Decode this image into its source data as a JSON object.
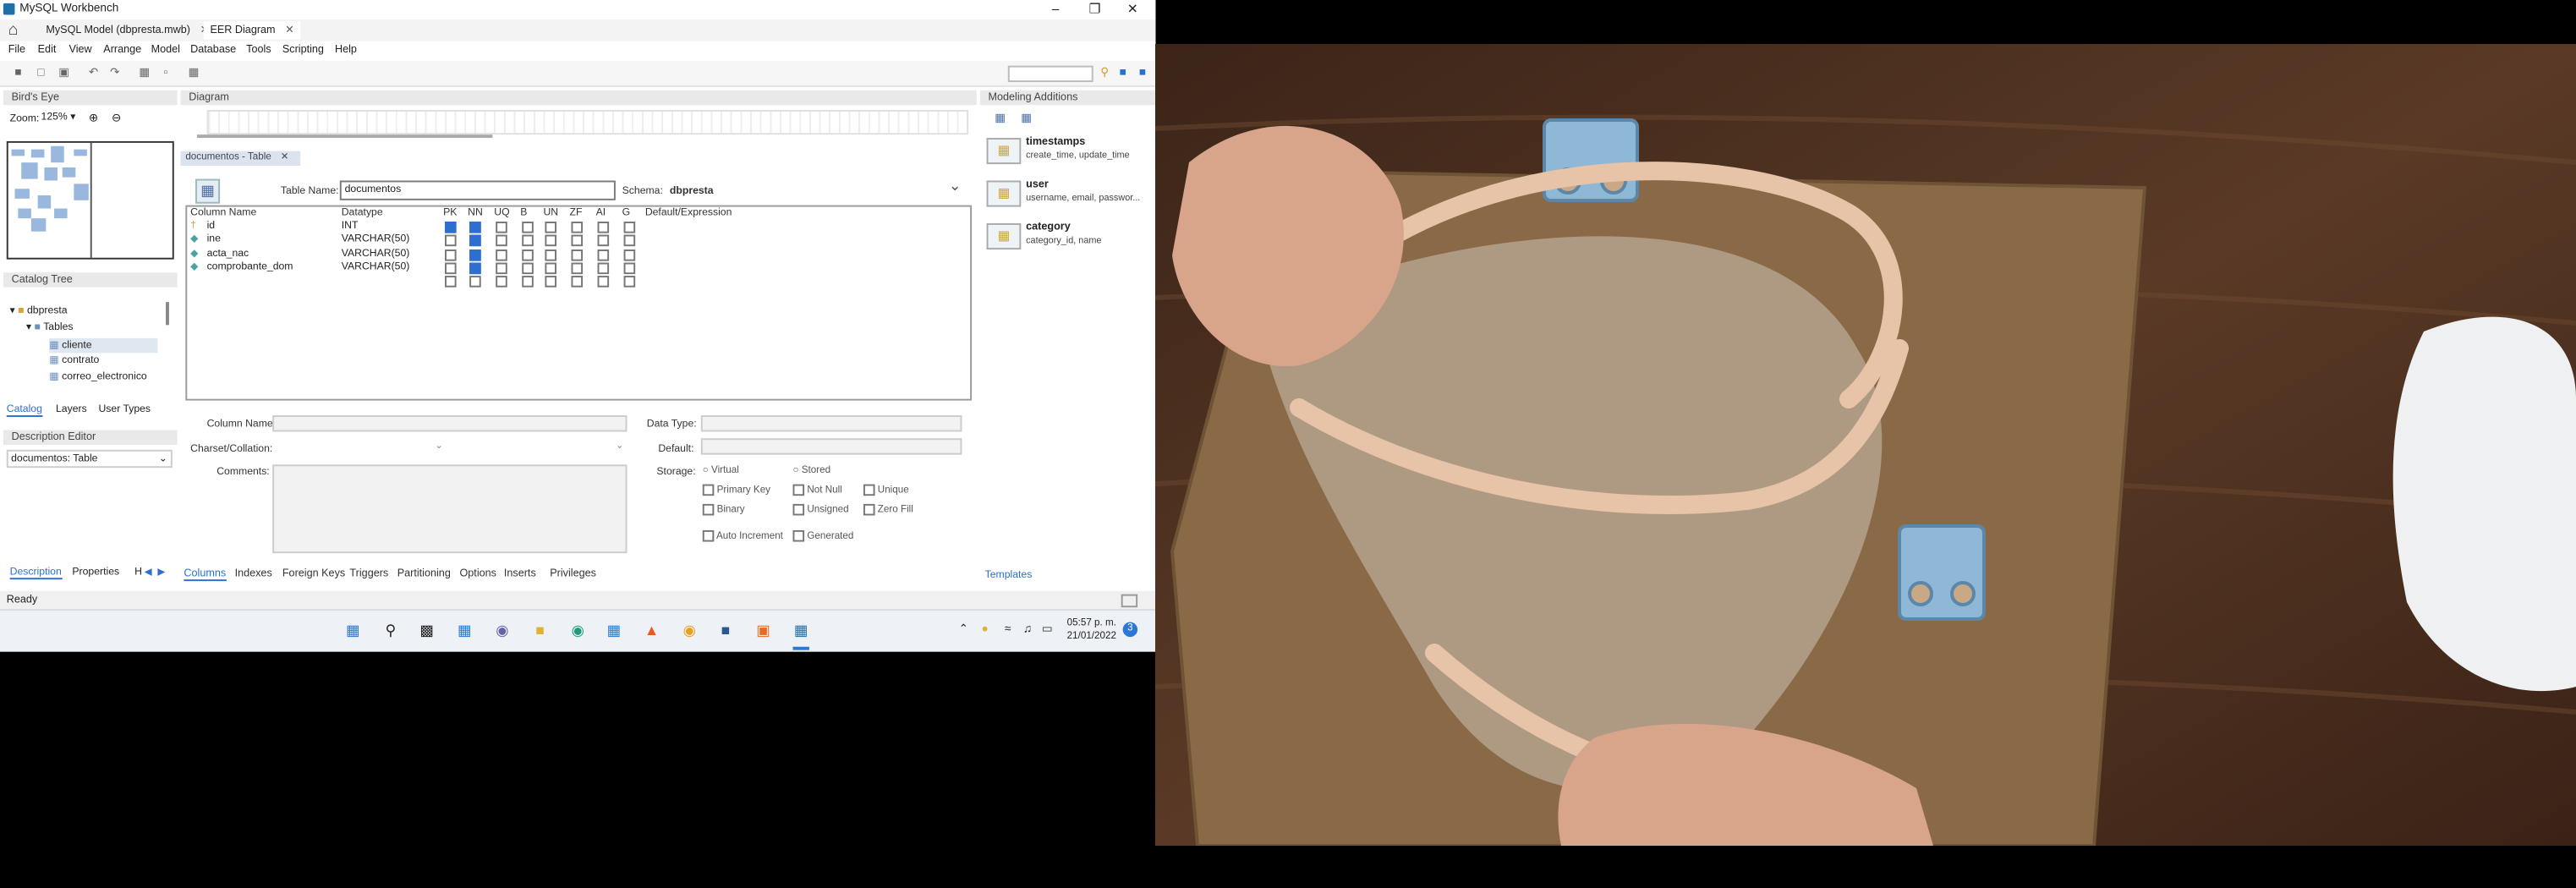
{
  "window": {
    "title": "MySQL Workbench"
  },
  "tabs": [
    {
      "label": "MySQL Model (dbpresta.mwb)"
    },
    {
      "label": "EER Diagram"
    }
  ],
  "menu": [
    "File",
    "Edit",
    "View",
    "Arrange",
    "Model",
    "Database",
    "Tools",
    "Scripting",
    "Help"
  ],
  "birds_eye": {
    "title": "Bird's Eye",
    "zoom_label": "Zoom:",
    "zoom_value": "125%"
  },
  "diagram": {
    "title": "Diagram",
    "doc_tab": "documentos - Table"
  },
  "catalog": {
    "title": "Catalog Tree",
    "schema": "dbpresta",
    "tables_label": "Tables",
    "tables": [
      "cliente",
      "contrato",
      "correo_electronico"
    ]
  },
  "left_tabs": [
    "Catalog",
    "Layers",
    "User Types"
  ],
  "description_editor": {
    "title": "Description Editor",
    "value": "documentos: Table"
  },
  "desc_tabs": [
    "Description",
    "Properties",
    "H"
  ],
  "table_editor": {
    "table_name_label": "Table Name:",
    "table_name": "documentos",
    "schema_label": "Schema:",
    "schema": "dbpresta",
    "headers": [
      "Column Name",
      "Datatype",
      "PK",
      "NN",
      "UQ",
      "B",
      "UN",
      "ZF",
      "AI",
      "G",
      "Default/Expression"
    ],
    "columns": [
      {
        "name": "id",
        "type": "INT",
        "pk": true,
        "nn": true
      },
      {
        "name": "ine",
        "type": "VARCHAR(50)",
        "pk": false,
        "nn": true
      },
      {
        "name": "acta_nac",
        "type": "VARCHAR(50)",
        "pk": false,
        "nn": true
      },
      {
        "name": "comprobante_dom",
        "type": "VARCHAR(50)",
        "pk": false,
        "nn": true
      }
    ],
    "details": {
      "column_name": "Column Name:",
      "charset": "Charset/Collation:",
      "comments": "Comments:",
      "data_type": "Data Type:",
      "default": "Default:",
      "storage": "Storage:",
      "opts": [
        "Virtual",
        "Stored",
        "Primary Key",
        "Not Null",
        "Unique",
        "Binary",
        "Unsigned",
        "Zero Fill",
        "Auto Increment",
        "Generated"
      ]
    },
    "bottom_tabs": [
      "Columns",
      "Indexes",
      "Foreign Keys",
      "Triggers",
      "Partitioning",
      "Options",
      "Inserts",
      "Privileges"
    ]
  },
  "modeling_additions": {
    "title": "Modeling Additions",
    "items": [
      {
        "title": "timestamps",
        "desc": "create_time, update_time"
      },
      {
        "title": "user",
        "desc": "username, email, passwor..."
      },
      {
        "title": "category",
        "desc": "category_id, name"
      }
    ],
    "templates_tab": "Templates"
  },
  "status": "Ready",
  "taskbar": {
    "time": "05:57 p. m.",
    "date": "21/01/2022",
    "badge": "3"
  }
}
